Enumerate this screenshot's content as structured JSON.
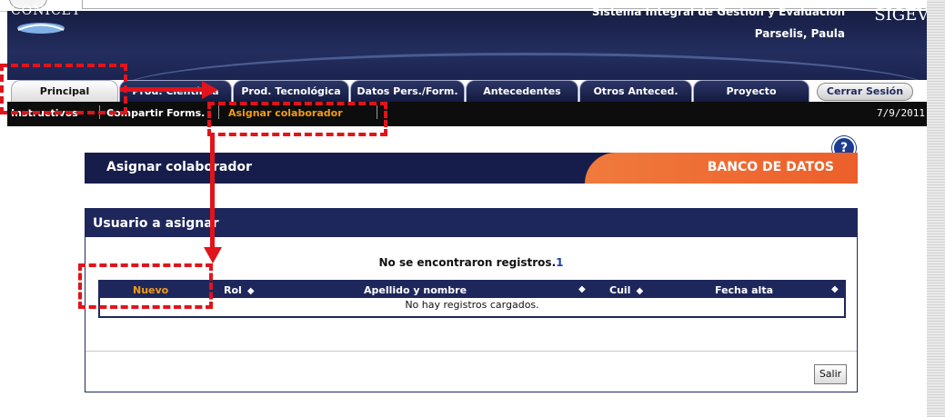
{
  "header": {
    "org_logo": "CONICET",
    "system_title": "Sistema Integral de Gestión y Evaluación",
    "user_name": "Parselis, Paula",
    "app_logo": "SIGEVA"
  },
  "tabs": [
    {
      "label": "Principal",
      "active": true
    },
    {
      "label": "Prod. Científica"
    },
    {
      "label": "Prod. Tecnológica"
    },
    {
      "label": "Datos Pers./Form."
    },
    {
      "label": "Antecedentes"
    },
    {
      "label": "Otros Anteced."
    },
    {
      "label": "Proyecto"
    }
  ],
  "logout_label": "Cerrar Sesión",
  "submenu": {
    "items": [
      {
        "label": "Instructivos"
      },
      {
        "label": "Compartir Forms."
      },
      {
        "label": "Asignar colaborador",
        "active": true
      }
    ],
    "date": "7/9/2011"
  },
  "help_icon": "help-icon",
  "banner": {
    "title": "Asignar colaborador",
    "section": "BANCO DE DATOS"
  },
  "panel": {
    "title": "Usuario a asignar",
    "no_records": "No se encontraron registros.",
    "page_number": "1",
    "table": {
      "columns": [
        "Nuevo",
        "Rol",
        "Apellido y nombre",
        "Cuil",
        "Fecha alta"
      ],
      "empty_message": "No hay registros cargados."
    },
    "exit_label": "Salir"
  },
  "colors": {
    "header_bg": "#1b2350",
    "accent_orange": "#f39c12",
    "annotation_red": "#e0141a",
    "panel_blue": "#1e275c"
  }
}
